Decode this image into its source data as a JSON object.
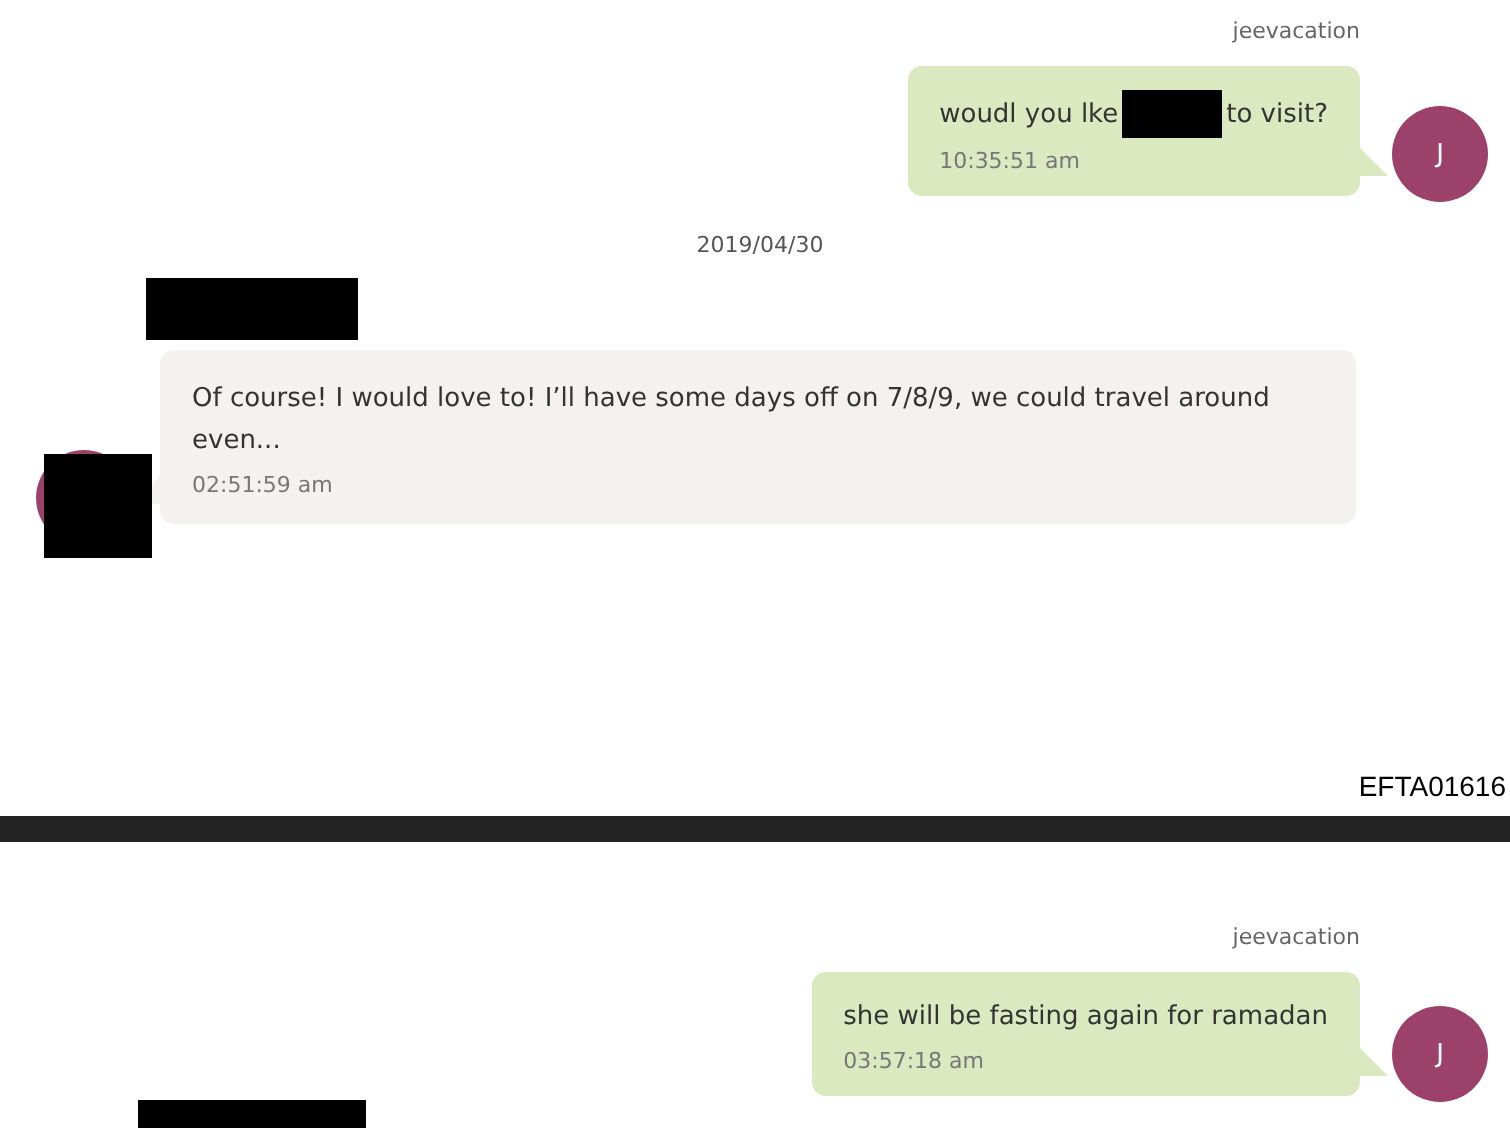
{
  "pages": [
    {
      "items": [
        {
          "kind": "outgoing",
          "sender": "jeevacation",
          "avatar": "J",
          "segments": [
            {
              "kind": "text",
              "text": "woudl you lke"
            },
            {
              "kind": "redaction"
            },
            {
              "kind": "text",
              "text": "to visit?"
            }
          ],
          "time": "10:35:51 am"
        },
        {
          "kind": "date",
          "text": "2019/04/30"
        },
        {
          "kind": "incoming",
          "sender_redacted": true,
          "avatar_redacted": true,
          "segments": [
            {
              "kind": "text",
              "text": "Of course! I would love to! I’ll have some days off on 7/8/9, we could travel around even..."
            }
          ],
          "time": "02:51:59 am"
        }
      ],
      "footer": "EFTA01616"
    },
    {
      "items": [
        {
          "kind": "outgoing",
          "sender": "jeevacation",
          "avatar": "J",
          "segments": [
            {
              "kind": "text",
              "text": "she will be fasting again for ramadan"
            }
          ],
          "time": "03:57:18 am"
        },
        {
          "kind": "redaction"
        }
      ]
    }
  ]
}
